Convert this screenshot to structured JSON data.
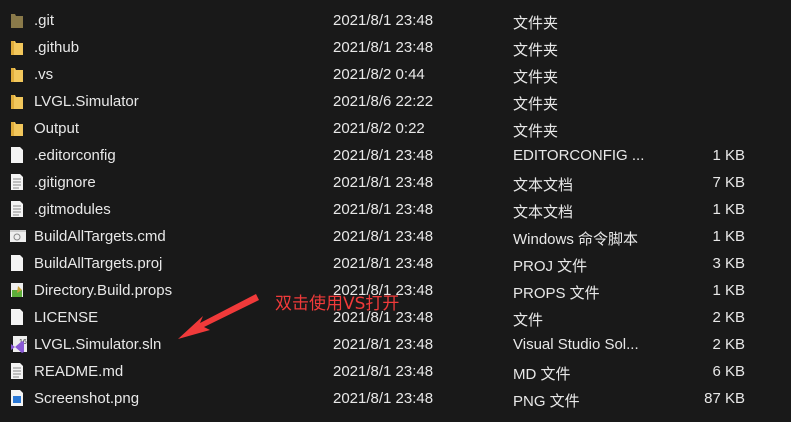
{
  "files": [
    {
      "name": ".git",
      "date": "2021/8/1 23:48",
      "type": "文件夹",
      "size": "",
      "icon": "folder-dark"
    },
    {
      "name": ".github",
      "date": "2021/8/1 23:48",
      "type": "文件夹",
      "size": "",
      "icon": "folder"
    },
    {
      "name": ".vs",
      "date": "2021/8/2 0:44",
      "type": "文件夹",
      "size": "",
      "icon": "folder"
    },
    {
      "name": "LVGL.Simulator",
      "date": "2021/8/6 22:22",
      "type": "文件夹",
      "size": "",
      "icon": "folder"
    },
    {
      "name": "Output",
      "date": "2021/8/2 0:22",
      "type": "文件夹",
      "size": "",
      "icon": "folder"
    },
    {
      "name": ".editorconfig",
      "date": "2021/8/1 23:48",
      "type": "EDITORCONFIG ...",
      "size": "1 KB",
      "icon": "file"
    },
    {
      "name": ".gitignore",
      "date": "2021/8/1 23:48",
      "type": "文本文档",
      "size": "7 KB",
      "icon": "text"
    },
    {
      "name": ".gitmodules",
      "date": "2021/8/1 23:48",
      "type": "文本文档",
      "size": "1 KB",
      "icon": "text"
    },
    {
      "name": "BuildAllTargets.cmd",
      "date": "2021/8/1 23:48",
      "type": "Windows 命令脚本",
      "size": "1 KB",
      "icon": "cmd"
    },
    {
      "name": "BuildAllTargets.proj",
      "date": "2021/8/1 23:48",
      "type": "PROJ 文件",
      "size": "3 KB",
      "icon": "file"
    },
    {
      "name": "Directory.Build.props",
      "date": "2021/8/1 23:48",
      "type": "PROPS 文件",
      "size": "1 KB",
      "icon": "props"
    },
    {
      "name": "LICENSE",
      "date": "2021/8/1 23:48",
      "type": "文件",
      "size": "2 KB",
      "icon": "file"
    },
    {
      "name": "LVGL.Simulator.sln",
      "date": "2021/8/1 23:48",
      "type": "Visual Studio Sol...",
      "size": "2 KB",
      "icon": "vs"
    },
    {
      "name": "README.md",
      "date": "2021/8/1 23:48",
      "type": "MD 文件",
      "size": "6 KB",
      "icon": "text"
    },
    {
      "name": "Screenshot.png",
      "date": "2021/8/1 23:48",
      "type": "PNG 文件",
      "size": "87 KB",
      "icon": "image"
    }
  ],
  "annotation": "双击使用VS打开",
  "colors": {
    "background": "#191919",
    "annotation": "#f03a3a",
    "folder": "#f2c75c"
  }
}
